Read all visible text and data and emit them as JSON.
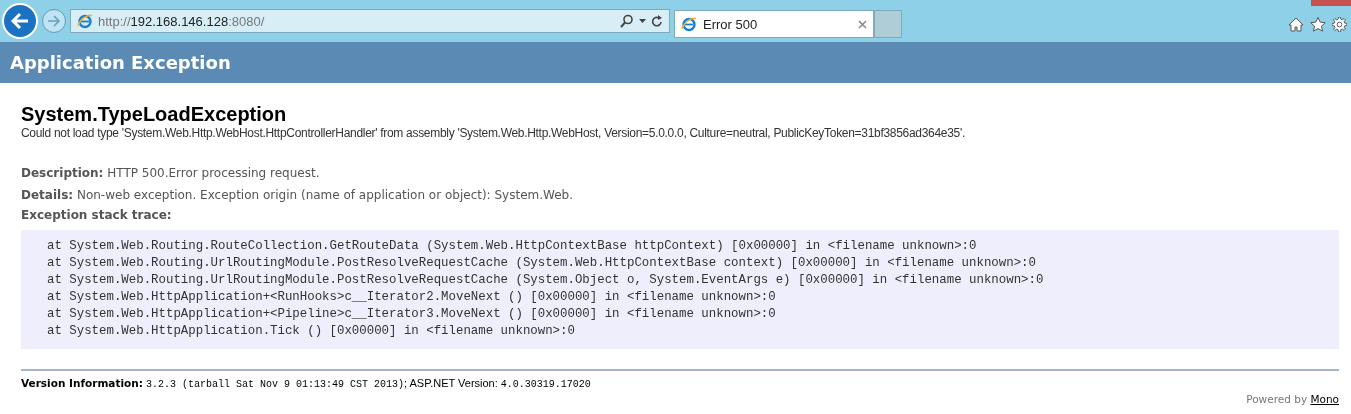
{
  "browser": {
    "url": {
      "scheme": "http://",
      "host": "192.168.146.128",
      "rest": ":8080/"
    },
    "tab": {
      "title": "Error 500",
      "selected": true
    }
  },
  "header": {
    "title": "Application Exception"
  },
  "exception": {
    "type": "System.TypeLoadException",
    "message": "Could not load type 'System.Web.Http.WebHost.HttpControllerHandler' from assembly 'System.Web.Http.WebHost, Version=5.0.0.0, Culture=neutral, PublicKeyToken=31bf3856ad364e35'."
  },
  "fields": [
    {
      "label": "Description:",
      "value": "HTTP 500.Error processing request."
    },
    {
      "label": "Details:",
      "value": "Non-web exception. Exception origin (name of application or object): System.Web."
    }
  ],
  "stack_trace": {
    "label": "Exception stack trace:",
    "lines": [
      "at System.Web.Routing.RouteCollection.GetRouteData (System.Web.HttpContextBase httpContext) [0x00000] in <filename unknown>:0",
      "at System.Web.Routing.UrlRoutingModule.PostResolveRequestCache (System.Web.HttpContextBase context) [0x00000] in <filename unknown>:0",
      "at System.Web.Routing.UrlRoutingModule.PostResolveRequestCache (System.Object o, System.EventArgs e) [0x00000] in <filename unknown>:0",
      "at System.Web.HttpApplication+<RunHooks>c__Iterator2.MoveNext () [0x00000] in <filename unknown>:0",
      "at System.Web.HttpApplication+<Pipeline>c__Iterator3.MoveNext () [0x00000] in <filename unknown>:0",
      "at System.Web.HttpApplication.Tick () [0x00000] in <filename unknown>:0"
    ]
  },
  "version": {
    "label": "Version Information:",
    "mono_version": "3.2.3 (tarball Sat Nov 9 01:13:49 CST 2013)",
    "separator": "; ASP.NET Version:",
    "aspnet_version": "4.0.30319.17020"
  },
  "powered_by": {
    "text": "Powered by",
    "link": "Mono"
  }
}
